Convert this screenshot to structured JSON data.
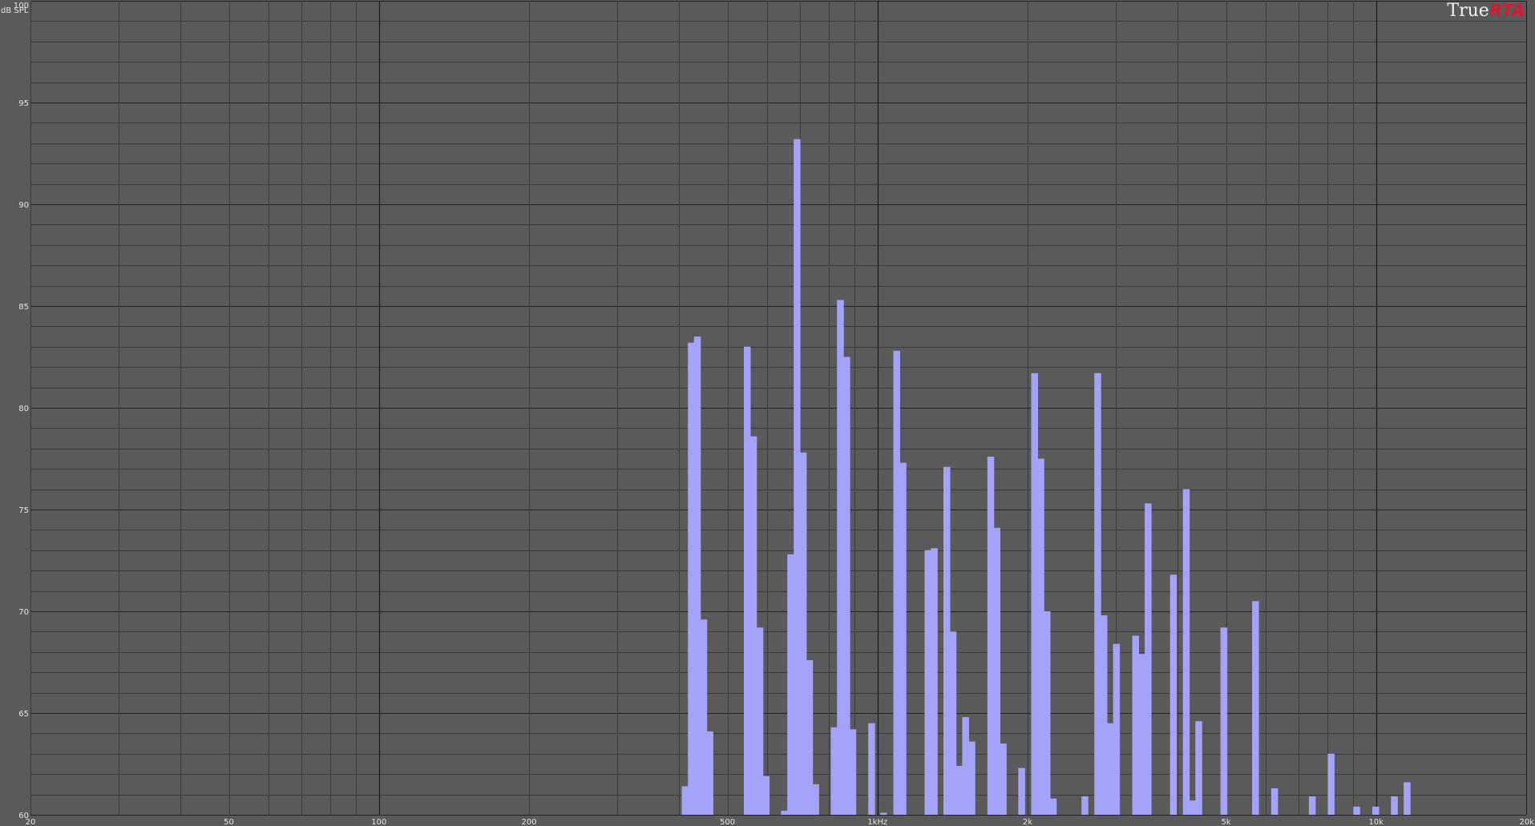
{
  "brand": {
    "prefix": "True",
    "suffix": "RTA"
  },
  "chart_data": {
    "type": "bar",
    "title": "",
    "xlabel": "",
    "ylabel": "dB SPL",
    "x_scale": "log",
    "xlim": [
      20,
      20000
    ],
    "ylim": [
      60,
      100
    ],
    "grid": true,
    "legend": "none",
    "colors": {
      "bars": "#a3a3fa",
      "background": "#5a5a5a",
      "grid_major": "#222222",
      "grid_minor": "#3a3a3a",
      "text": "#e6e6e6",
      "brand_accent": "#e0142e"
    },
    "y_ticks": [
      100,
      95,
      90,
      85,
      80,
      75,
      70,
      65,
      60
    ],
    "x_ticks": [
      {
        "value": 20,
        "label": "20"
      },
      {
        "value": 50,
        "label": "50"
      },
      {
        "value": 100,
        "label": "100"
      },
      {
        "value": 200,
        "label": "200"
      },
      {
        "value": 500,
        "label": "500"
      },
      {
        "value": 1000,
        "label": "1kHz"
      },
      {
        "value": 2000,
        "label": "2k"
      },
      {
        "value": 5000,
        "label": "5k"
      },
      {
        "value": 10000,
        "label": "10k"
      },
      {
        "value": 20000,
        "label": "20k"
      }
    ],
    "bars": [
      {
        "f": 412,
        "v": 61.4
      },
      {
        "f": 424,
        "v": 83.2
      },
      {
        "f": 436,
        "v": 83.5
      },
      {
        "f": 449,
        "v": 69.6
      },
      {
        "f": 462,
        "v": 64.1
      },
      {
        "f": 549,
        "v": 83.0
      },
      {
        "f": 565,
        "v": 78.6
      },
      {
        "f": 582,
        "v": 69.2
      },
      {
        "f": 599,
        "v": 61.9
      },
      {
        "f": 652,
        "v": 60.2
      },
      {
        "f": 671,
        "v": 72.8
      },
      {
        "f": 691,
        "v": 93.2
      },
      {
        "f": 711,
        "v": 77.8
      },
      {
        "f": 732,
        "v": 67.6
      },
      {
        "f": 753,
        "v": 61.5
      },
      {
        "f": 820,
        "v": 64.3
      },
      {
        "f": 844,
        "v": 85.3
      },
      {
        "f": 869,
        "v": 82.5
      },
      {
        "f": 894,
        "v": 64.2
      },
      {
        "f": 975,
        "v": 64.5
      },
      {
        "f": 1030,
        "v": 60.1
      },
      {
        "f": 1095,
        "v": 82.8
      },
      {
        "f": 1127,
        "v": 77.3
      },
      {
        "f": 1265,
        "v": 73.0
      },
      {
        "f": 1302,
        "v": 73.1
      },
      {
        "f": 1380,
        "v": 77.1
      },
      {
        "f": 1420,
        "v": 69.0
      },
      {
        "f": 1462,
        "v": 62.4
      },
      {
        "f": 1505,
        "v": 64.8
      },
      {
        "f": 1549,
        "v": 63.6
      },
      {
        "f": 1690,
        "v": 77.6
      },
      {
        "f": 1739,
        "v": 74.1
      },
      {
        "f": 1790,
        "v": 63.5
      },
      {
        "f": 1950,
        "v": 62.3
      },
      {
        "f": 2070,
        "v": 81.7
      },
      {
        "f": 2130,
        "v": 77.5
      },
      {
        "f": 2192,
        "v": 70.0
      },
      {
        "f": 2256,
        "v": 60.8
      },
      {
        "f": 2610,
        "v": 60.9
      },
      {
        "f": 2770,
        "v": 81.7
      },
      {
        "f": 2851,
        "v": 69.8
      },
      {
        "f": 2934,
        "v": 64.5
      },
      {
        "f": 3020,
        "v": 68.4
      },
      {
        "f": 3300,
        "v": 68.8
      },
      {
        "f": 3397,
        "v": 67.9
      },
      {
        "f": 3496,
        "v": 75.3
      },
      {
        "f": 3930,
        "v": 71.8
      },
      {
        "f": 4170,
        "v": 76.0
      },
      {
        "f": 4292,
        "v": 60.7
      },
      {
        "f": 4417,
        "v": 64.6
      },
      {
        "f": 4960,
        "v": 69.2
      },
      {
        "f": 5740,
        "v": 70.5
      },
      {
        "f": 6270,
        "v": 61.3
      },
      {
        "f": 7460,
        "v": 60.9
      },
      {
        "f": 8140,
        "v": 63.0
      },
      {
        "f": 9160,
        "v": 60.4
      },
      {
        "f": 10000,
        "v": 60.4
      },
      {
        "f": 10900,
        "v": 60.9
      },
      {
        "f": 11560,
        "v": 61.6
      }
    ]
  }
}
